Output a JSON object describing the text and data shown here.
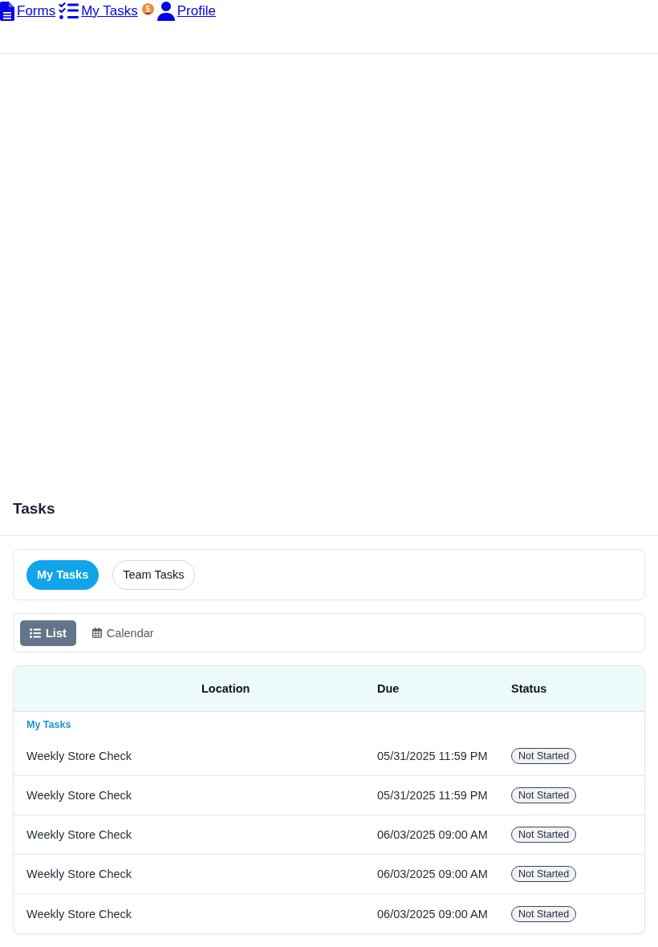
{
  "nav": {
    "links": [
      {
        "label": "Forms"
      },
      {
        "label": "My Tasks",
        "badge": "5"
      },
      {
        "label": "Profile"
      }
    ]
  },
  "page": {
    "title": "Tasks"
  },
  "scope_tabs": [
    {
      "label": "My Tasks",
      "selected": true
    },
    {
      "label": "Team Tasks",
      "selected": false
    }
  ],
  "view_tabs": [
    {
      "label": "List",
      "selected": true
    },
    {
      "label": "Calendar",
      "selected": false
    }
  ],
  "table": {
    "columns": [
      "Location",
      "Due",
      "Status"
    ],
    "groups": [
      {
        "title": "My Tasks",
        "rows": [
          {
            "column_1": "Weekly Store Check",
            "due": "05/31/2025 11:59 PM",
            "status": "Not Started"
          },
          {
            "column_1": "Weekly Store Check",
            "due": "05/31/2025 11:59 PM",
            "status": "Not Started"
          },
          {
            "column_1": "Weekly Store Check",
            "due": "06/03/2025 09:00 AM",
            "status": "Not Started"
          },
          {
            "column_1": "Weekly Store Check",
            "due": "06/03/2025 09:00 AM",
            "status": "Not Started"
          },
          {
            "column_1": "Weekly Store Check",
            "due": "06/03/2025 09:00 AM",
            "status": "Not Started"
          }
        ]
      }
    ]
  }
}
